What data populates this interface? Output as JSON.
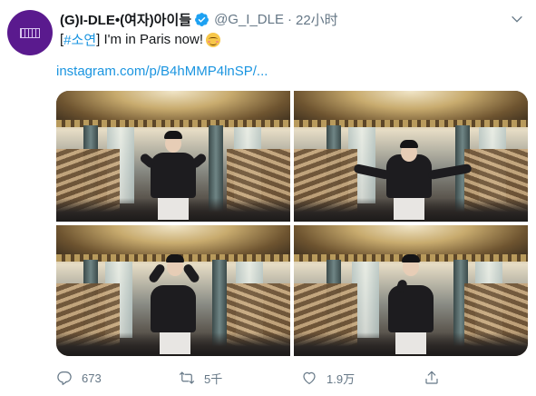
{
  "user": {
    "display_name": "(G)I-DLE•(여자)아이들",
    "handle": "@G_I_DLE",
    "separator": "·",
    "time": "22小时"
  },
  "tweet": {
    "hashtag_open": "[",
    "hashtag": "#소연",
    "hashtag_close": "]",
    "text": " I'm in Paris now!",
    "emoji": "smiling-face-with-blush-icon",
    "link": "instagram.com/p/B4hMMP4lnSP/..."
  },
  "media": {
    "photos": [
      {
        "pose": "arms-akimbo"
      },
      {
        "pose": "arms-outstretched"
      },
      {
        "pose": "hands-on-head"
      },
      {
        "pose": "holding-phone"
      }
    ]
  },
  "actions": {
    "reply_count": "673",
    "retweet_count": "5千",
    "like_count": "1.9万",
    "reply_icon": "reply-icon",
    "retweet_icon": "retweet-icon",
    "like_icon": "heart-icon",
    "share_icon": "share-icon"
  },
  "colors": {
    "link": "#1b95e0",
    "muted": "#657786",
    "avatar_bg": "#5a1a8e",
    "verified": "#1da1f2"
  }
}
